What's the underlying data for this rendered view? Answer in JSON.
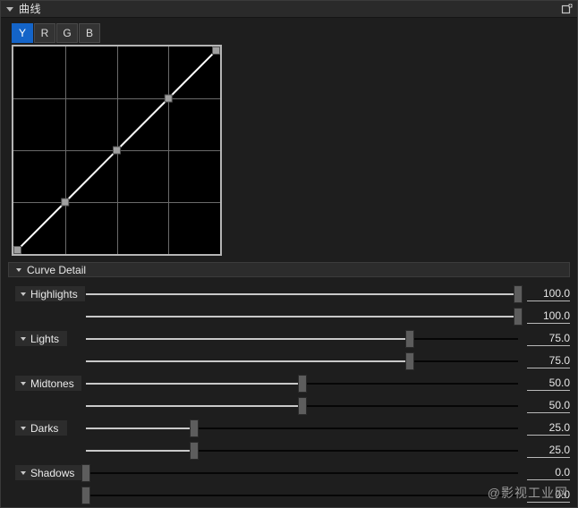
{
  "window": {
    "title": "曲线",
    "collapse_icon": "triangle-down-icon",
    "node_icon": "add-node-icon"
  },
  "channels": {
    "tabs": [
      {
        "label": "Y",
        "active": true
      },
      {
        "label": "R",
        "active": false
      },
      {
        "label": "G",
        "active": false
      },
      {
        "label": "B",
        "active": false
      }
    ],
    "active_color": "#1464c8"
  },
  "curve_editor": {
    "grid_divisions": 4,
    "grid_color": "#6a6a6a",
    "background": "#000000",
    "curve_color": "#ffffff",
    "point_color": "#a0a0a0",
    "control_points": [
      {
        "x": 0.0,
        "y": 0.0
      },
      {
        "x": 0.25,
        "y": 0.25
      },
      {
        "x": 0.5,
        "y": 0.5
      },
      {
        "x": 0.75,
        "y": 0.75
      },
      {
        "x": 1.0,
        "y": 1.0
      }
    ]
  },
  "curve_detail": {
    "header_label": "Curve Detail",
    "groups": [
      {
        "label": "Highlights",
        "sliders": [
          {
            "value": "100.0",
            "percent": 100
          },
          {
            "value": "100.0",
            "percent": 100
          }
        ]
      },
      {
        "label": "Lights",
        "sliders": [
          {
            "value": "75.0",
            "percent": 75
          },
          {
            "value": "75.0",
            "percent": 75
          }
        ]
      },
      {
        "label": "Midtones",
        "sliders": [
          {
            "value": "50.0",
            "percent": 50
          },
          {
            "value": "50.0",
            "percent": 50
          }
        ]
      },
      {
        "label": "Darks",
        "sliders": [
          {
            "value": "25.0",
            "percent": 25
          },
          {
            "value": "25.0",
            "percent": 25
          }
        ]
      },
      {
        "label": "Shadows",
        "sliders": [
          {
            "value": "0.0",
            "percent": 0
          },
          {
            "value": "0.0",
            "percent": 0
          }
        ]
      }
    ]
  },
  "watermark": {
    "text": "@影视工业网"
  }
}
